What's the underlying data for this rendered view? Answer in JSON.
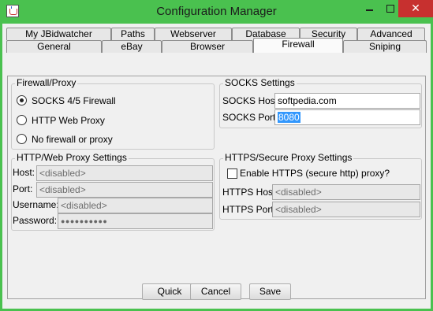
{
  "window": {
    "title": "Configuration Manager",
    "close_glyph": "✕"
  },
  "tabs_row1": [
    "My JBidwatcher",
    "Paths",
    "Webserver",
    "Database",
    "Security",
    "Advanced"
  ],
  "tabs_row2": [
    "General",
    "eBay",
    "Browser",
    "Firewall",
    "Sniping"
  ],
  "active_tab": "Firewall",
  "firewall_proxy": {
    "title": "Firewall/Proxy",
    "options": [
      "SOCKS 4/5 Firewall",
      "HTTP Web Proxy",
      "No firewall or proxy"
    ],
    "selected_index": 0
  },
  "socks": {
    "title": "SOCKS Settings",
    "host_label": "SOCKS Host:",
    "host_value": "softpedia.com",
    "port_label": "SOCKS Port:",
    "port_value": "8080"
  },
  "http_proxy": {
    "title": "HTTP/Web Proxy Settings",
    "host_label": "Host:",
    "host_value": "<disabled>",
    "port_label": "Port:",
    "port_value": "<disabled>",
    "username_label": "Username:",
    "username_value": "<disabled>",
    "password_label": "Password:",
    "password_value": "●●●●●●●●●●"
  },
  "https_proxy": {
    "title": "HTTPS/Secure Proxy Settings",
    "enable_label": "Enable HTTPS (secure http) proxy?",
    "enable_checked": false,
    "host_label": "HTTPS Host:",
    "host_value": "<disabled>",
    "port_label": "HTTPS Port:",
    "port_value": "<disabled>"
  },
  "buttons": {
    "quick": "Quick",
    "cancel": "Cancel",
    "save": "Save"
  }
}
